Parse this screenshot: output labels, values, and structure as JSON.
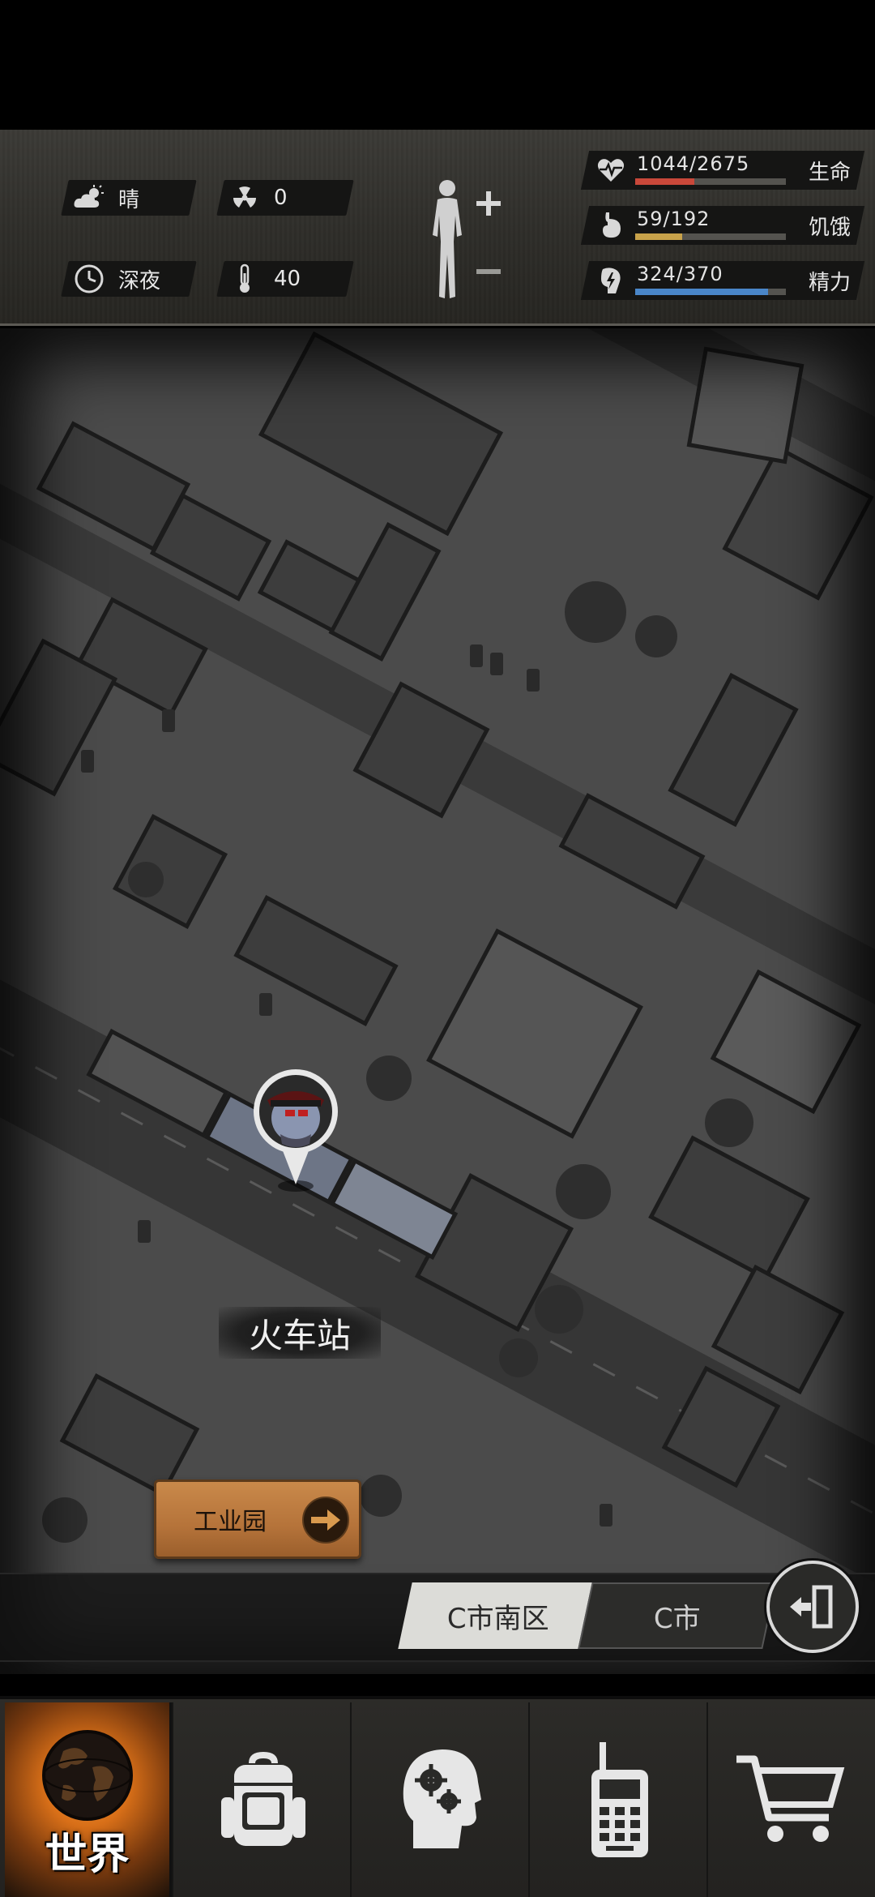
{
  "status": {
    "weather": "晴",
    "radiation": "0",
    "time_of_day": "深夜",
    "temperature": "40"
  },
  "vitals": [
    {
      "icon": "heartbeat-icon",
      "value": "1044/2675",
      "label": "生命",
      "fraction": 0.39,
      "color": "#c9483a"
    },
    {
      "icon": "stomach-icon",
      "value": "59/192",
      "label": "饥饿",
      "fraction": 0.31,
      "color": "#c8a24a"
    },
    {
      "icon": "energy-icon",
      "value": "324/370",
      "label": "精力",
      "fraction": 0.88,
      "color": "#4a86c8"
    }
  ],
  "map": {
    "location_name": "火车站",
    "nav_button_label": "工业园",
    "breadcrumb": {
      "district": "C市南区",
      "city": "C市"
    }
  },
  "bottom_nav": {
    "world_label": "世界",
    "tabs": [
      "world-tab",
      "backpack-tab",
      "skills-tab",
      "radio-tab",
      "shop-tab"
    ]
  },
  "colors": {
    "accent_orange": "#d86f18",
    "health_red": "#c9483a",
    "hunger_gold": "#c8a24a",
    "energy_blue": "#4a86c8"
  }
}
